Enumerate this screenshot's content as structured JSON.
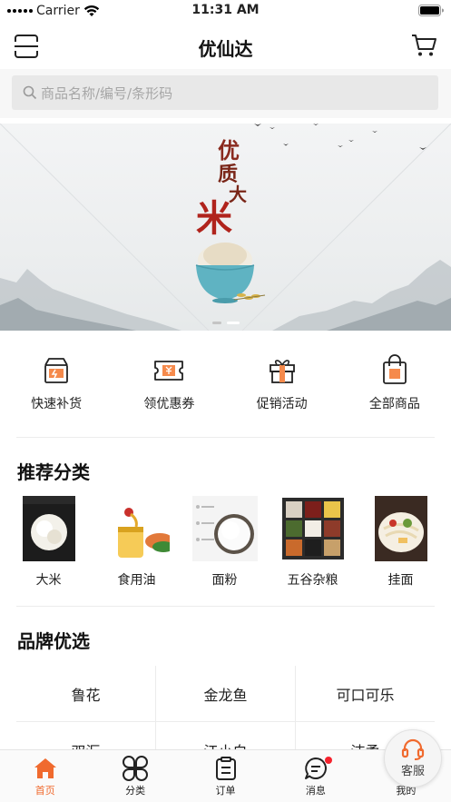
{
  "status_bar": {
    "carrier": "Carrier",
    "time": "11:31 AM"
  },
  "nav": {
    "title": "优仙达"
  },
  "search": {
    "placeholder": "商品名称/编号/条形码"
  },
  "banner": {
    "title_chars": [
      "优",
      "质",
      "大",
      "米"
    ]
  },
  "quick_entries": [
    {
      "label": "快速补货",
      "icon": "restock-box-icon"
    },
    {
      "label": "领优惠券",
      "icon": "coupon-icon"
    },
    {
      "label": "促销活动",
      "icon": "gift-box-icon"
    },
    {
      "label": "全部商品",
      "icon": "shopping-bag-icon"
    }
  ],
  "recommended": {
    "title": "推荐分类",
    "items": [
      {
        "label": "大米"
      },
      {
        "label": "食用油"
      },
      {
        "label": "面粉"
      },
      {
        "label": "五谷杂粮"
      },
      {
        "label": "挂面"
      }
    ]
  },
  "brands": {
    "title": "品牌优选",
    "items": [
      "鲁花",
      "金龙鱼",
      "可口可乐",
      "双汇",
      "江小白",
      "洁柔"
    ]
  },
  "service": {
    "label": "客服"
  },
  "tab_bar": {
    "items": [
      {
        "label": "首页",
        "icon": "home-icon",
        "active": true
      },
      {
        "label": "分类",
        "icon": "category-icon",
        "active": false
      },
      {
        "label": "订单",
        "icon": "order-icon",
        "active": false
      },
      {
        "label": "消息",
        "icon": "message-icon",
        "active": false,
        "badge": true
      },
      {
        "label": "我的",
        "icon": "profile-icon",
        "active": false
      }
    ]
  },
  "colors": {
    "accent": "#f06a2e",
    "badge": "#f5222d"
  }
}
